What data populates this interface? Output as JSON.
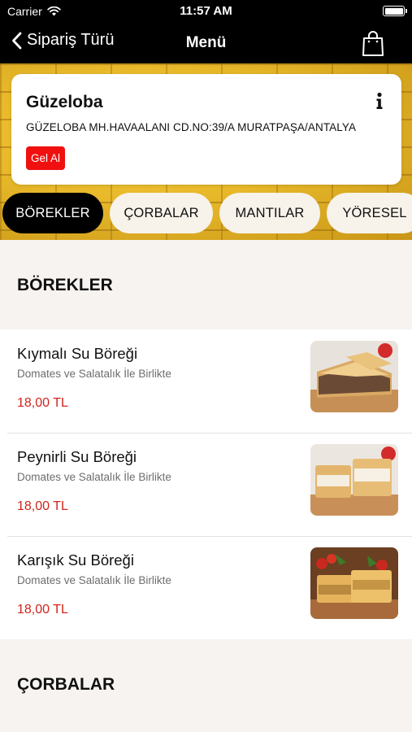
{
  "status_bar": {
    "carrier": "Carrier",
    "time": "11:57 AM"
  },
  "nav": {
    "back_label": "Sipariş Türü",
    "title": "Menü"
  },
  "restaurant": {
    "name": "Güzeloba",
    "address": "GÜZELOBA MH.HAVAALANI CD.NO:39/A MURATPAŞA/ANTALYA",
    "order_type_badge": "Gel Al"
  },
  "categories": [
    {
      "label": "BÖREKLER",
      "active": true
    },
    {
      "label": "ÇORBALAR",
      "active": false
    },
    {
      "label": "MANTILAR",
      "active": false
    },
    {
      "label": "YÖRESEL",
      "active": false
    }
  ],
  "sections": [
    {
      "title": "BÖREKLER",
      "items": [
        {
          "name": "Kıymalı Su Böreği",
          "description": "Domates ve Salatalık İle Birlikte",
          "price": "18,00 TL"
        },
        {
          "name": "Peynirli Su Böreği",
          "description": "Domates ve Salatalık İle Birlikte",
          "price": "18,00 TL"
        },
        {
          "name": "Karışık Su Böreği",
          "description": "Domates ve Salatalık İle Birlikte",
          "price": "18,00 TL"
        }
      ]
    },
    {
      "title": "ÇORBALAR",
      "items": []
    }
  ],
  "colors": {
    "accent_price": "#d0241c",
    "badge": "#f01010",
    "nav_background": "#000000"
  },
  "icons": [
    "wifi-icon",
    "battery-icon",
    "back-chevron-icon",
    "shopping-bag-icon",
    "info-icon"
  ]
}
